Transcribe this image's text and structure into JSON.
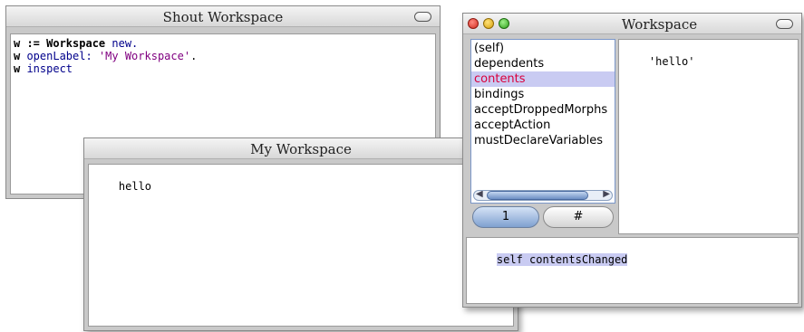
{
  "shout_workspace": {
    "title": "Shout Workspace",
    "code_lines": [
      {
        "parts": [
          {
            "t": "w := ",
            "c": "kw"
          },
          {
            "t": "Workspace",
            "c": "kw"
          },
          {
            "t": " new.",
            "c": "blue"
          }
        ]
      },
      {
        "parts": [
          {
            "t": "w ",
            "c": "kw"
          },
          {
            "t": "openLabel: ",
            "c": "blue"
          },
          {
            "t": "'My Workspace'",
            "c": "str"
          },
          {
            "t": ".",
            "c": ""
          }
        ]
      },
      {
        "parts": [
          {
            "t": "w ",
            "c": "kw"
          },
          {
            "t": "inspect",
            "c": "blue"
          }
        ]
      }
    ]
  },
  "my_workspace": {
    "title": "My Workspace",
    "content": "hello"
  },
  "inspector": {
    "title": "Workspace",
    "fields": [
      "(self)",
      "dependents",
      "contents",
      "bindings",
      "acceptDroppedMorphs",
      "acceptAction",
      "mustDeclareVariables"
    ],
    "selected_field": "contents",
    "value_text": "'hello'",
    "button_left_label": "1",
    "button_right_label": "#",
    "eval_text": "self contentsChanged"
  },
  "colors": {
    "selection_bg": "#c9cbf2",
    "selection_text": "#d9003c",
    "window_bg": "#c9c9c9"
  }
}
